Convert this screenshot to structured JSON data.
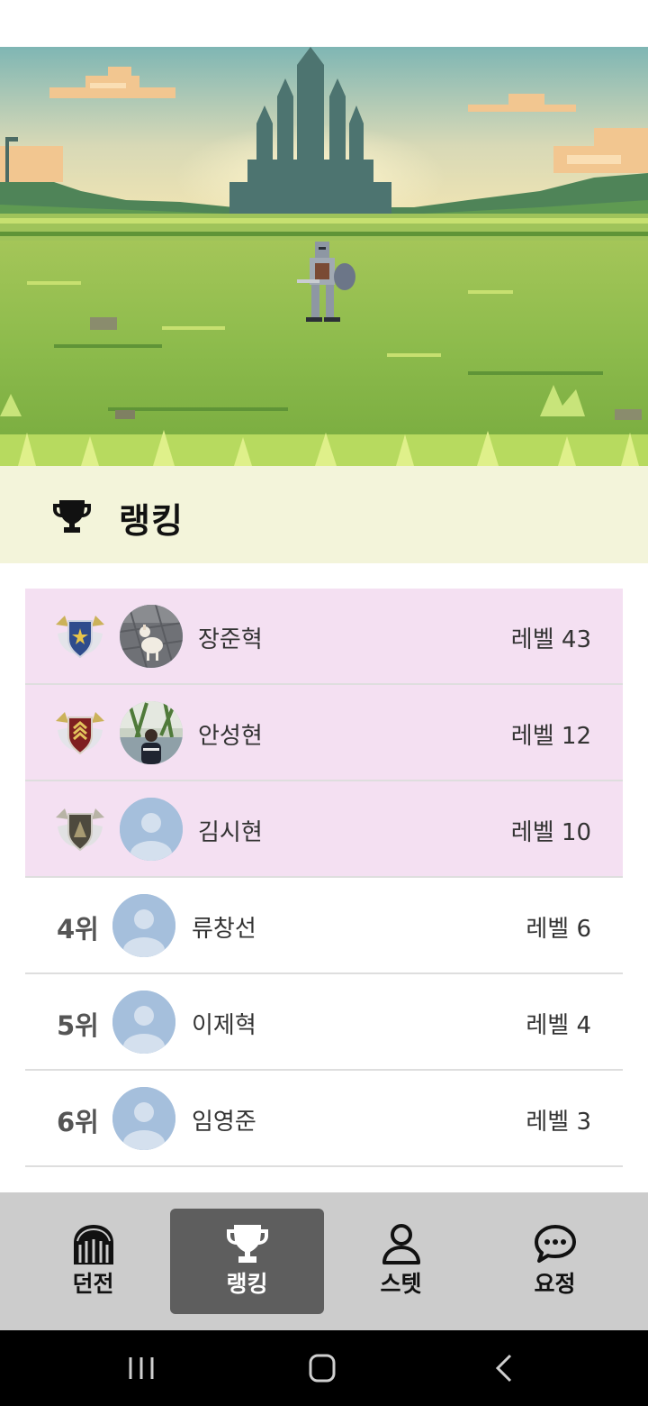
{
  "ranking_header": {
    "title": "랭킹",
    "icon": "trophy-icon"
  },
  "rankings": [
    {
      "rank_label": "",
      "badge": "gold-shield-badge",
      "name": "장준혁",
      "level": "레벨 43",
      "avatar": "dog-photo"
    },
    {
      "rank_label": "",
      "badge": "silver-shield-badge",
      "name": "안성현",
      "level": "레벨 12",
      "avatar": "person-photo"
    },
    {
      "rank_label": "",
      "badge": "bronze-shield-badge",
      "name": "김시현",
      "level": "레벨 10",
      "avatar": "default-avatar"
    },
    {
      "rank_label": "4위",
      "name": "류창선",
      "level": "레벨 6",
      "avatar": "default-avatar"
    },
    {
      "rank_label": "5위",
      "name": "이제혁",
      "level": "레벨 4",
      "avatar": "default-avatar"
    },
    {
      "rank_label": "6위",
      "name": "임영준",
      "level": "레벨 3",
      "avatar": "default-avatar"
    }
  ],
  "bottom_nav": [
    {
      "label": "던전",
      "icon": "dungeon-gate-icon",
      "active": false
    },
    {
      "label": "랭킹",
      "icon": "trophy-icon",
      "active": true
    },
    {
      "label": "스텟",
      "icon": "person-icon",
      "active": false
    },
    {
      "label": "요정",
      "icon": "chat-bubble-icon",
      "active": false
    }
  ],
  "colors": {
    "header_bg": "#f3f4da",
    "top_rank_bg": "#f4e0f2",
    "nav_bg": "#cccccc",
    "nav_active_bg": "#5e5e5e",
    "avatar_default": "#a5bfdc"
  }
}
